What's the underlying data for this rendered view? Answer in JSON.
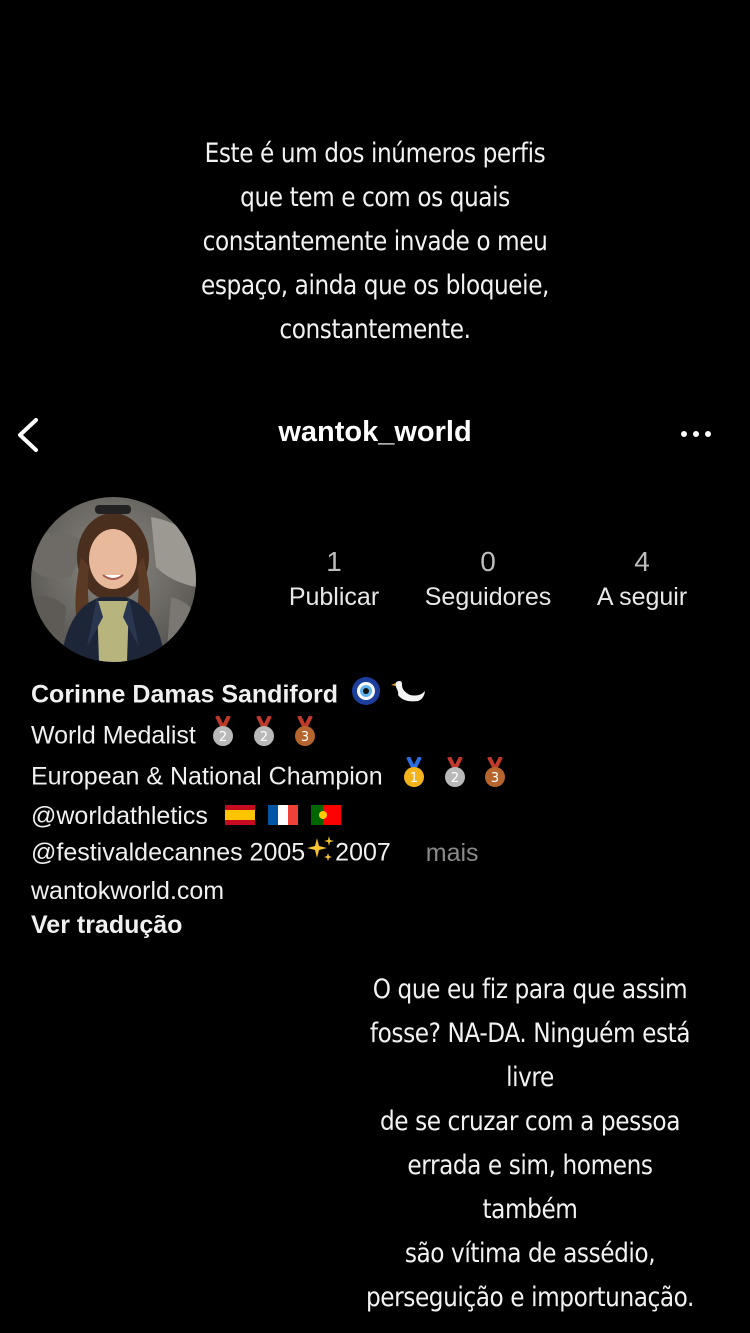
{
  "story": {
    "top_lines": [
      "Este é um dos inúmeros perfis",
      "que tem e com os quais",
      "constantemente invade o meu",
      "espaço, ainda que os bloqueie,",
      "constantemente."
    ],
    "bottom_lines": [
      "O que eu fiz para que assim",
      "fosse? NA-DA. Ninguém está livre",
      "de se cruzar com a pessoa",
      "errada e sim, homens também",
      "são vítima de assédio,",
      "perseguição e importunação."
    ]
  },
  "header": {
    "username": "wantok_world",
    "back_icon": "chevron-left-icon",
    "more_icon": "more-horizontal-icon"
  },
  "stats": [
    {
      "value": "1",
      "label": "Publicar"
    },
    {
      "value": "0",
      "label": "Seguidores"
    },
    {
      "value": "4",
      "label": "A seguir"
    }
  ],
  "bio": {
    "name": "Corinne Damas Sandiford",
    "line1": "World Medalist",
    "line2": "European & National Champion",
    "line3": "@worldathletics",
    "line4": "@festivaldecannes 2005",
    "line4_end": "2007",
    "more": "mais",
    "website": "wantokworld.com",
    "translate": "Ver tradução"
  }
}
